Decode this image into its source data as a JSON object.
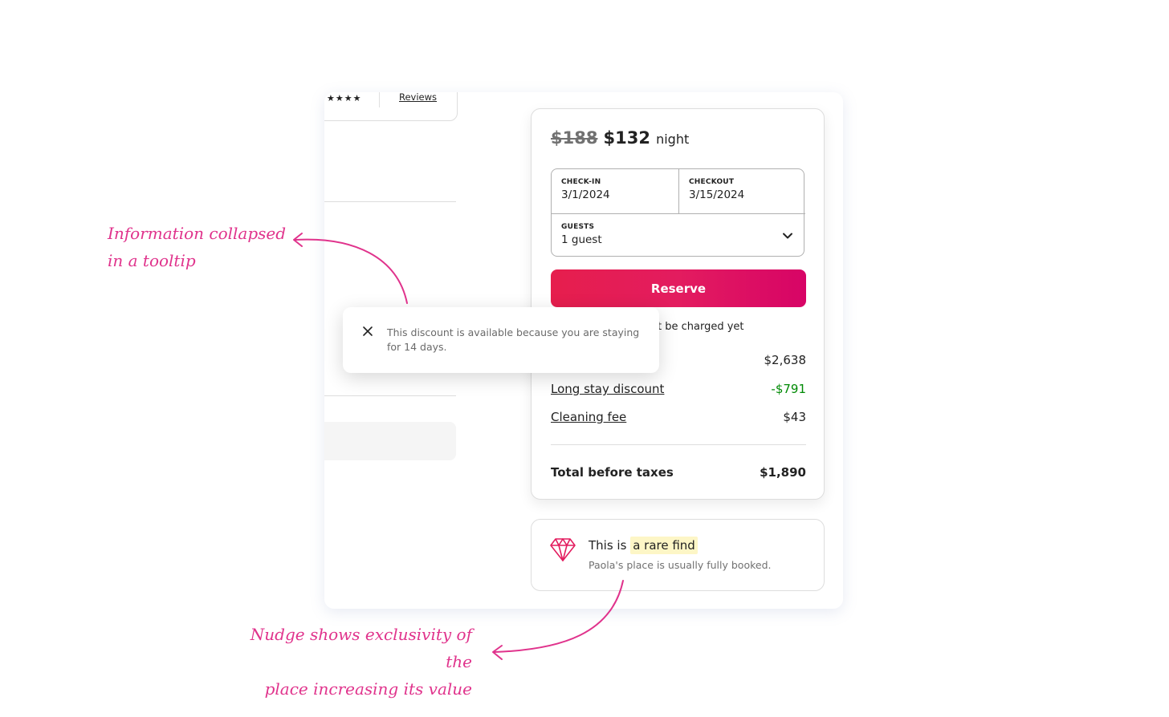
{
  "listing": {
    "reviews_link": "Reviews",
    "stars": "★★★★"
  },
  "booking": {
    "old_price": "$188",
    "new_price": "$132",
    "per": "night",
    "checkin_label": "CHECK-IN",
    "checkin_value": "3/1/2024",
    "checkout_label": "CHECKOUT",
    "checkout_value": "3/15/2024",
    "guests_label": "GUESTS",
    "guests_value": "1 guest",
    "reserve_label": "Reserve",
    "charged_note": "t be charged yet",
    "lines": [
      {
        "label": "",
        "value": "$2,638"
      },
      {
        "label": "Long stay discount",
        "value": "-$791"
      },
      {
        "label": "Cleaning fee",
        "value": "$43"
      }
    ],
    "total_label": "Total before taxes",
    "total_value": "$1,890",
    "accent_color": "#e31c5f",
    "discount_color": "#008a05"
  },
  "rare_find": {
    "prefix": "This is",
    "highlight": "a rare find",
    "subtitle": "Paola's place is usually fully booked.",
    "icon": "diamond-icon"
  },
  "tooltip": {
    "text": "This discount is available because you are staying for 14 days.",
    "close_icon": "close-icon"
  },
  "annotations": {
    "tooltip_note_line1": "Information collapsed",
    "tooltip_note_line2": "in a tooltip",
    "nudge_note_line1": "Nudge shows exclusivity of the",
    "nudge_note_line2": "place increasing its value",
    "color": "#e0338c"
  }
}
